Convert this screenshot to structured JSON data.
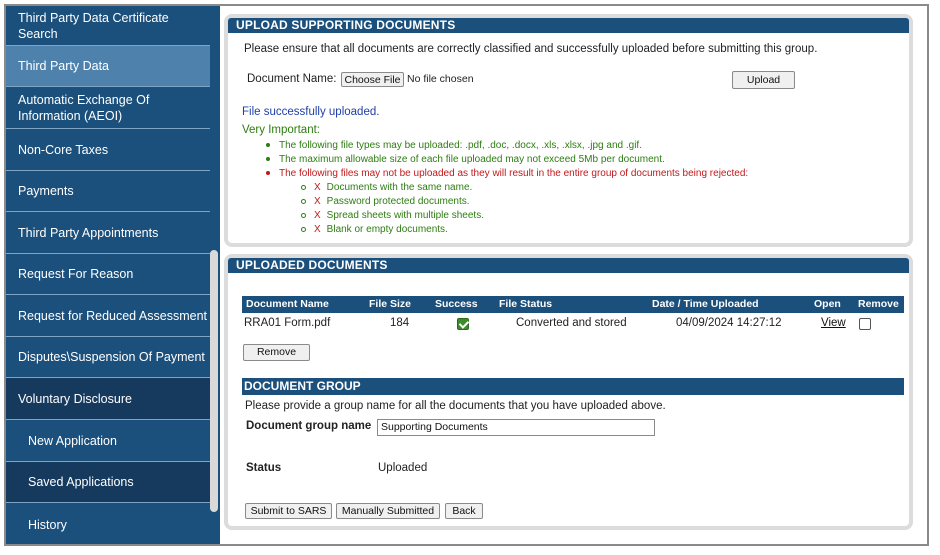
{
  "sidebar": {
    "items": [
      {
        "label": "Third Party Data Certificate Search"
      },
      {
        "label": "Third Party Data"
      },
      {
        "label": "Automatic Exchange Of Information (AEOI)"
      },
      {
        "label": "Non-Core Taxes"
      },
      {
        "label": "Payments"
      },
      {
        "label": "Third Party Appointments"
      },
      {
        "label": "Request For Reason"
      },
      {
        "label": "Request for Reduced Assessment"
      },
      {
        "label": "Disputes\\Suspension Of Payment"
      },
      {
        "label": "Voluntary Disclosure"
      },
      {
        "label": "New Application"
      },
      {
        "label": "Saved Applications"
      },
      {
        "label": "History"
      }
    ]
  },
  "upload_section": {
    "title": "UPLOAD SUPPORTING DOCUMENTS",
    "instruction": "Please ensure that all documents are correctly classified and successfully uploaded before submitting this group.",
    "document_name_label": "Document Name:",
    "choose_file_label": "Choose File",
    "no_file_text": "No file chosen",
    "upload_button": "Upload",
    "success_message": "File successfully uploaded.",
    "important_heading": "Very Important:",
    "rules": [
      "The following file types may be uploaded: .pdf, .doc, .docx, .xls, .xlsx, .jpg and .gif.",
      "The maximum allowable size of each file uploaded may not exceed 5Mb per document.",
      "The following files may not be uploaded as they will result in the entire group of documents being rejected:"
    ],
    "rejected": [
      "Documents with the same name.",
      "Password protected documents.",
      "Spread sheets with multiple sheets.",
      "Blank or empty documents."
    ],
    "x_mark": "X"
  },
  "uploaded_section": {
    "title": "UPLOADED DOCUMENTS",
    "columns": [
      "Document Name",
      "File Size",
      "Success",
      "File Status",
      "Date / Time Uploaded",
      "Open",
      "Remove"
    ],
    "rows": [
      {
        "name": "RRA01 Form.pdf",
        "size": "184",
        "success": true,
        "status": "Converted and stored",
        "uploaded": "04/09/2024 14:27:12",
        "open": "View",
        "remove": false
      }
    ],
    "remove_button": "Remove"
  },
  "document_group": {
    "title": "DOCUMENT GROUP",
    "instruction": "Please provide a group name for all the documents that you have uploaded above.",
    "group_name_label": "Document group name",
    "group_name_value": "Supporting Documents",
    "status_label": "Status",
    "status_value": "Uploaded",
    "submit_button": "Submit to SARS",
    "manual_button": "Manually Submitted",
    "back_button": "Back"
  }
}
